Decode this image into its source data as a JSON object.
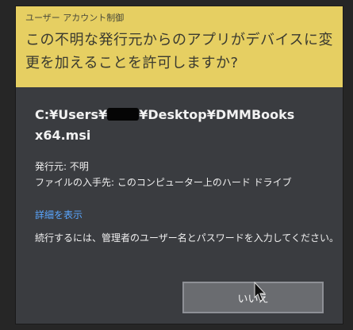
{
  "dialog": {
    "title": "ユーザー アカウント制御",
    "question": "この不明な発行元からのアプリがデバイスに変更を加えることを許可しますか?",
    "program_name_prefix": "C:¥Users¥",
    "program_name_suffix": "¥Desktop¥DMMBooks x64.msi",
    "publisher": "発行元: 不明",
    "file_origin": "ファイルの入手先: このコンピューター上のハード ドライブ",
    "details_link": "詳細を表示",
    "instruction": "続行するには、管理者のユーザー名とパスワードを入力してください。",
    "no_button": "いいえ"
  },
  "colors": {
    "header_bg": "#e6cf62",
    "dialog_bg": "#3a3c40",
    "link": "#5aa6ff"
  },
  "icons": {
    "cursor": "mouse-pointer-icon"
  }
}
